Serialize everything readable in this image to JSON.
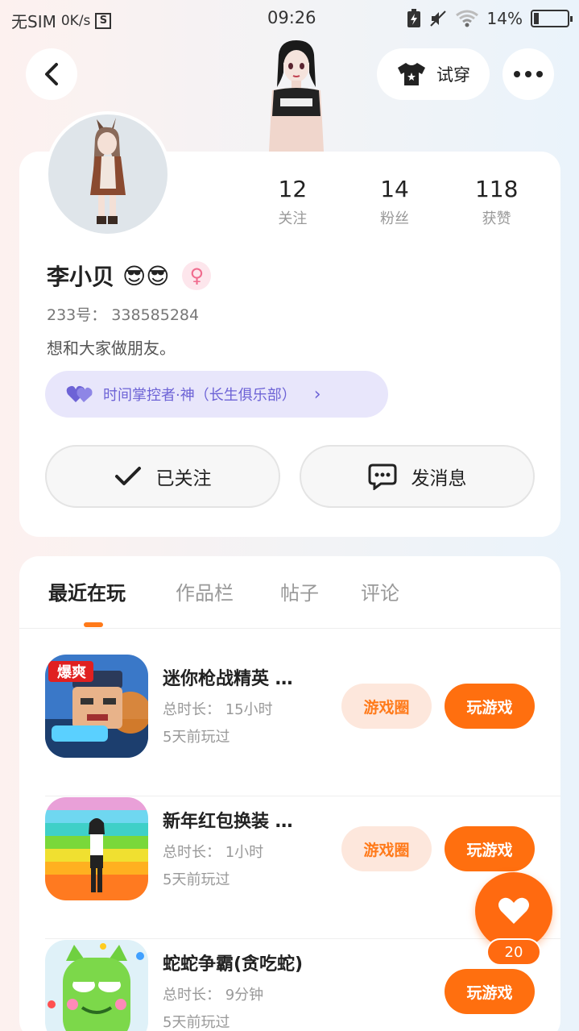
{
  "status_bar": {
    "carrier": "无SIM",
    "speed": "0K/s",
    "sim_badge": "S",
    "time": "09:26",
    "battery": "14%",
    "battery_level": 0.14
  },
  "header": {
    "try_on_label": "试穿"
  },
  "profile": {
    "stats": [
      {
        "value": "12",
        "label": "关注"
      },
      {
        "value": "14",
        "label": "粉丝"
      },
      {
        "value": "118",
        "label": "获赞"
      }
    ],
    "name": "李小贝",
    "name_emojis": "😎😎",
    "gender_icon": "♀",
    "uid": "233号： 338585284",
    "bio": "想和大家做朋友。",
    "club_badge": "时间掌控者·神（长生俱乐部）",
    "follow_label": "已关注",
    "message_label": "发消息"
  },
  "tabs": [
    "最近在玩",
    "作品栏",
    "帖子",
    "评论"
  ],
  "games": [
    {
      "title": "迷你枪战精英 …",
      "duration": "总时长： 15小时",
      "last_played": "5天前玩过",
      "circle_label": "游戏圈",
      "play_label": "玩游戏",
      "icon_badge": "爆爽"
    },
    {
      "title": "新年红包换装 …",
      "duration": "总时长： 1小时",
      "last_played": "5天前玩过",
      "circle_label": "游戏圈",
      "play_label": "玩游戏"
    },
    {
      "title": "蛇蛇争霸(贪吃蛇)",
      "duration": "总时长： 9分钟",
      "last_played": "5天前玩过",
      "play_label": "玩游戏"
    }
  ],
  "like_fab": {
    "count": "20"
  },
  "colors": {
    "accent": "#ff6f0f",
    "badge_purple": "#6d63d6"
  }
}
